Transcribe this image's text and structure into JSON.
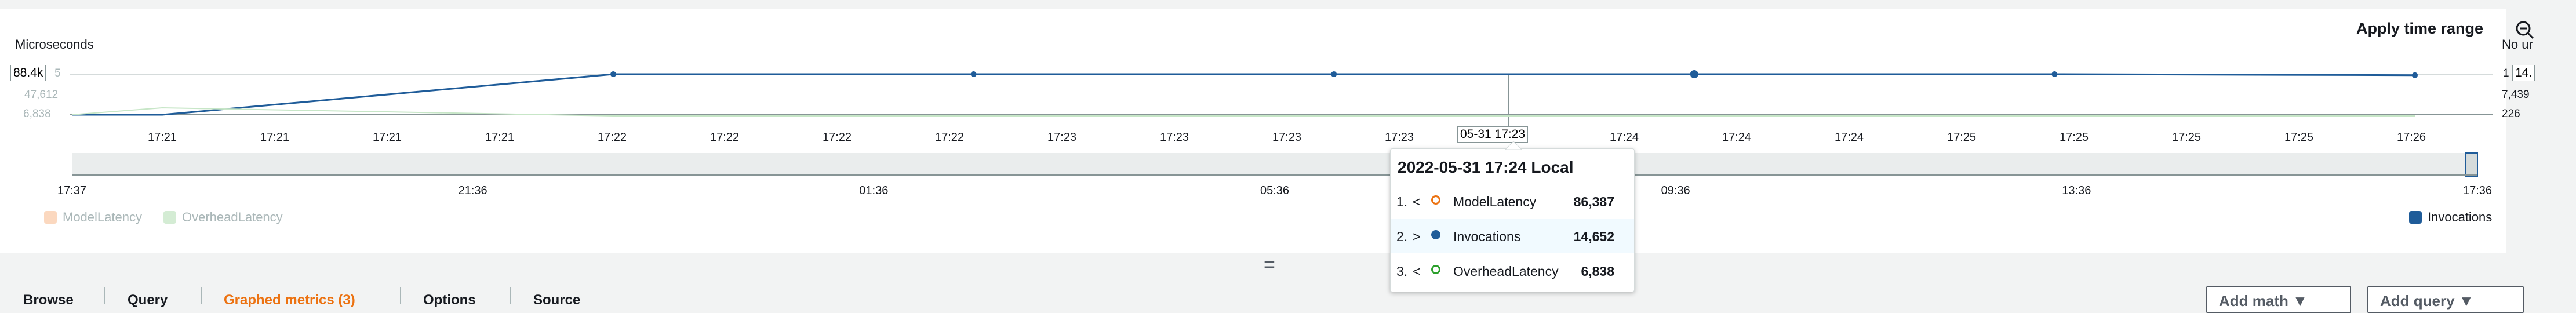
{
  "panel": {
    "y_label": "Microseconds",
    "apply_time_range": "Apply time range",
    "no_units": "No ur",
    "left_axis": {
      "top_box": "88.4k",
      "top_box_suffix": "5",
      "mid": "47,612",
      "low": "6,838"
    },
    "right_axis": {
      "top_box_prefix": "1",
      "top_box": "14.",
      "mid": "7,439",
      "low": "226"
    },
    "focus_time_label": "05-31 17:23",
    "x_ticks": [
      "17:21",
      "17:21",
      "17:21",
      "17:21",
      "17:22",
      "17:22",
      "17:22",
      "17:22",
      "17:23",
      "17:23",
      "17:23",
      "17:23",
      "17:24",
      "17:24",
      "17:24",
      "17:24",
      "17:25",
      "17:25",
      "17:25",
      "17:25",
      "17:26"
    ],
    "timeline_ticks": [
      "17:37",
      "21:36",
      "01:36",
      "05:36",
      "09:36",
      "13:36",
      "17:36"
    ]
  },
  "legend": {
    "model_latency": "ModelLatency",
    "overhead_latency": "OverheadLatency",
    "invocations": "Invocations",
    "colors": {
      "model": "#ec7211",
      "invocations": "#1f5c99",
      "overhead": "#2ca02c"
    }
  },
  "tooltip": {
    "title": "2022-05-31 17:24 Local",
    "rows": [
      {
        "index": "1.",
        "arrow": "<",
        "name": "ModelLatency",
        "value": "86,387"
      },
      {
        "index": "2.",
        "arrow": ">",
        "name": "Invocations",
        "value": "14,652"
      },
      {
        "index": "3.",
        "arrow": "<",
        "name": "OverheadLatency",
        "value": "6,838"
      }
    ]
  },
  "tabs": [
    "Browse",
    "Query",
    "Graphed metrics (3)",
    "Options",
    "Source"
  ],
  "buttons": {
    "add_math": "Add math",
    "add_query": "Add query"
  },
  "chart_data": {
    "type": "line",
    "x": [
      "17:21",
      "17:22",
      "17:23",
      "17:24",
      "17:25",
      "17:26"
    ],
    "series": [
      {
        "name": "Invocations",
        "values": [
          14652,
          14652,
          14652,
          14652,
          14652,
          14300
        ]
      },
      {
        "name": "ModelLatency",
        "values": [
          86387,
          86387,
          86387,
          86387,
          86387,
          86387
        ]
      },
      {
        "name": "OverheadLatency",
        "values": [
          6838,
          6838,
          6838,
          6838,
          6838,
          6838
        ]
      }
    ]
  }
}
